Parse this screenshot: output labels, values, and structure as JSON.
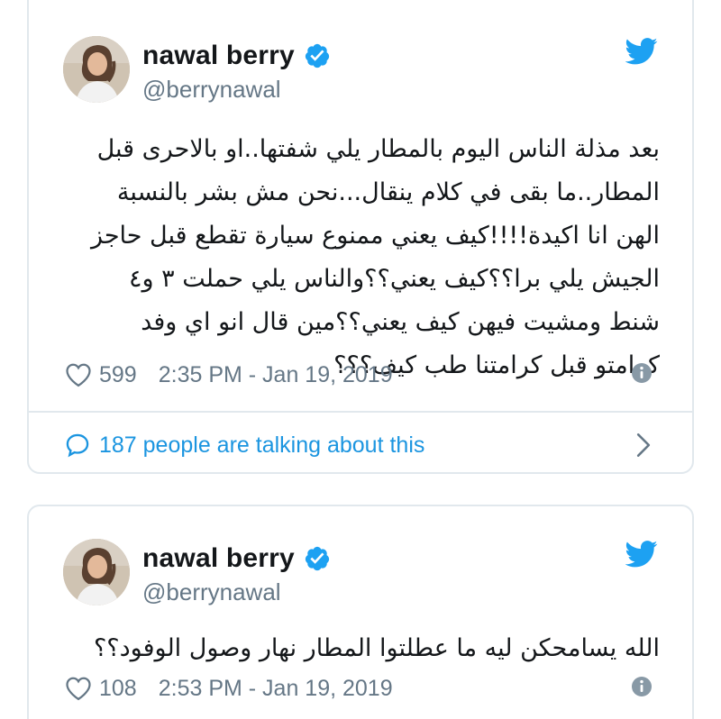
{
  "tweets": [
    {
      "author": {
        "name": "nawal berry",
        "handle": "@berrynawal"
      },
      "text": "بعد مذلة الناس اليوم بالمطار يلي شفتها..او بالاحرى قبل المطار..ما بقى في كلام ينقال...نحن مش بشر بالنسبة الهن انا اكيدة!!!!كيف يعني ممنوع سيارة تقطع قبل حاجز الجيش يلي برا؟؟كيف يعني؟؟والناس يلي حملت ٣ و٤ شنط ومشيت فيهن كيف يعني؟؟مين قال انو اي وفد كرامتو قبل كرامتنا طب كيف؟؟؟",
      "likes": "599",
      "timestamp": "2:35 PM - Jan 19, 2019",
      "conversation": "187 people are talking about this"
    },
    {
      "author": {
        "name": "nawal berry",
        "handle": "@berrynawal"
      },
      "text": "الله يسامحكن ليه ما عطلتوا المطار نهار وصول الوفود؟؟",
      "likes": "108",
      "timestamp": "2:53 PM - Jan 19, 2019"
    }
  ],
  "icons": {
    "verified": "verified-badge-icon",
    "brand": "twitter-bird-icon",
    "like": "heart-icon",
    "info": "info-icon",
    "reply": "speech-bubble-icon",
    "more": "chevron-right-icon"
  },
  "colors": {
    "brand_blue": "#1da1f2",
    "link_blue": "#1b95e0",
    "text_primary": "#14171a",
    "text_secondary": "#657786",
    "border": "#e1e8ed"
  }
}
